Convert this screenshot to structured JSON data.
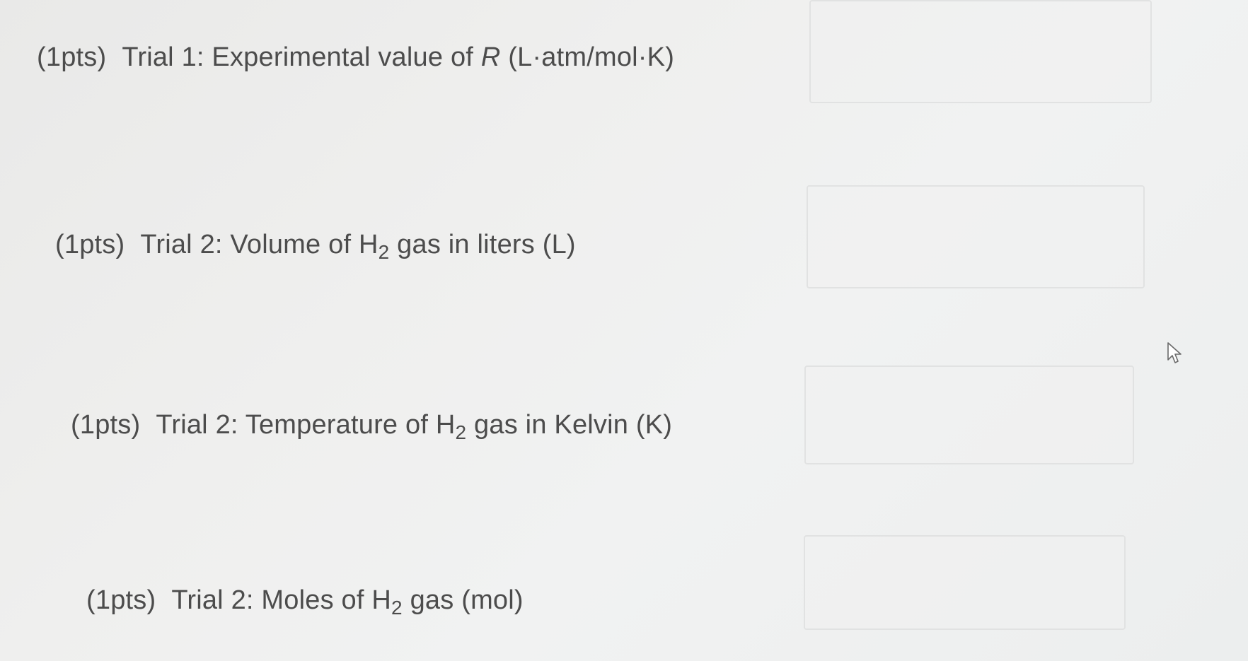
{
  "questions": [
    {
      "points": "(1pts)",
      "text_before": "Trial 1: Experimental value of ",
      "italic": "R",
      "text_after": " (L·atm/mol·K)",
      "answer_value": ""
    },
    {
      "points": "(1pts)",
      "text_before": "Trial 2: Volume of H",
      "subscript": "2",
      "text_after": " gas in liters (L)",
      "answer_value": ""
    },
    {
      "points": "(1pts)",
      "text_before": "Trial 2: Temperature of H",
      "subscript": "2",
      "text_after": " gas in Kelvin (K)",
      "answer_value": ""
    },
    {
      "points": "(1pts)",
      "text_before": "Trial 2: Moles of H",
      "subscript": "2",
      "text_after": " gas (mol)",
      "answer_value": ""
    }
  ],
  "cursor_icon": "mouse-pointer-icon"
}
